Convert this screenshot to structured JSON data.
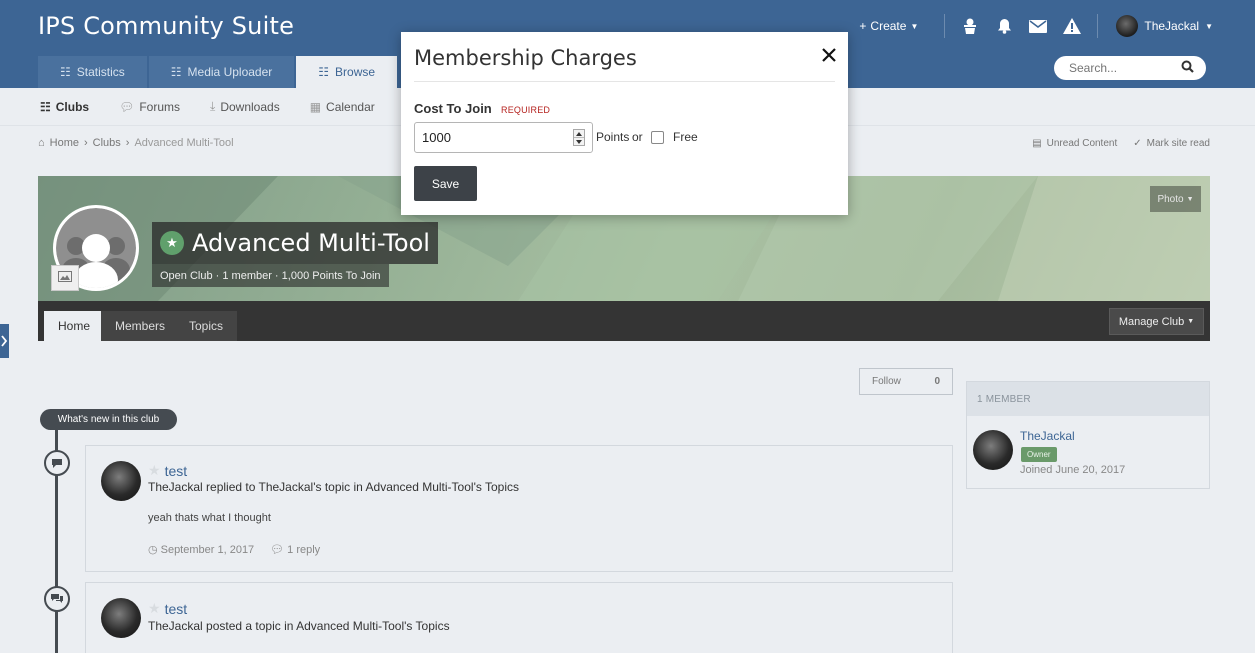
{
  "header": {
    "site_title": "IPS Community Suite",
    "create_label": "Create",
    "username": "TheJackal"
  },
  "nav": {
    "tabs": [
      {
        "label": "Statistics",
        "icon": "grid-icon"
      },
      {
        "label": "Media Uploader",
        "icon": "grid-icon"
      },
      {
        "label": "Browse",
        "icon": "grid-icon"
      }
    ]
  },
  "search": {
    "placeholder": "Search..."
  },
  "subnav": {
    "items": [
      {
        "label": "Clubs",
        "icon": "grid-icon"
      },
      {
        "label": "Forums",
        "icon": "comments-icon"
      },
      {
        "label": "Downloads",
        "icon": "download-icon"
      },
      {
        "label": "Calendar",
        "icon": "calendar-icon"
      }
    ]
  },
  "breadcrumb": {
    "home": "Home",
    "clubs": "Clubs",
    "current": "Advanced Multi-Tool"
  },
  "page_actions": {
    "unread": "Unread Content",
    "mark_read": "Mark site read"
  },
  "club": {
    "name": "Advanced Multi-Tool",
    "meta": "Open Club · 1 member · 1,000 Points To Join",
    "photo_label": "Photo",
    "tabs": [
      "Home",
      "Members",
      "Topics"
    ],
    "manage_label": "Manage Club"
  },
  "follow": {
    "label": "Follow",
    "count": "0"
  },
  "timeline": {
    "pill": "What's new in this club",
    "posts": [
      {
        "title": "test",
        "subtitle": "TheJackal replied to TheJackal's topic in Advanced Multi-Tool's Topics",
        "body": "yeah thats what I thought",
        "date": "September 1, 2017",
        "replies": "1 reply"
      },
      {
        "title": "test",
        "subtitle": "TheJackal posted a topic in Advanced Multi-Tool's Topics"
      }
    ]
  },
  "sidebar": {
    "heading": "1 MEMBER",
    "member_name": "TheJackal",
    "badge": "Owner",
    "joined": "Joined June 20, 2017"
  },
  "modal": {
    "title": "Membership Charges",
    "field_label": "Cost To Join",
    "required": "REQUIRED",
    "cost_value": "1000",
    "points_label": "Points",
    "or_label": "or",
    "free_label": "Free",
    "save_label": "Save"
  },
  "colors": {
    "header_bg": "#3d6594",
    "button_dark": "#3d4248",
    "required_red": "#b5231f"
  }
}
